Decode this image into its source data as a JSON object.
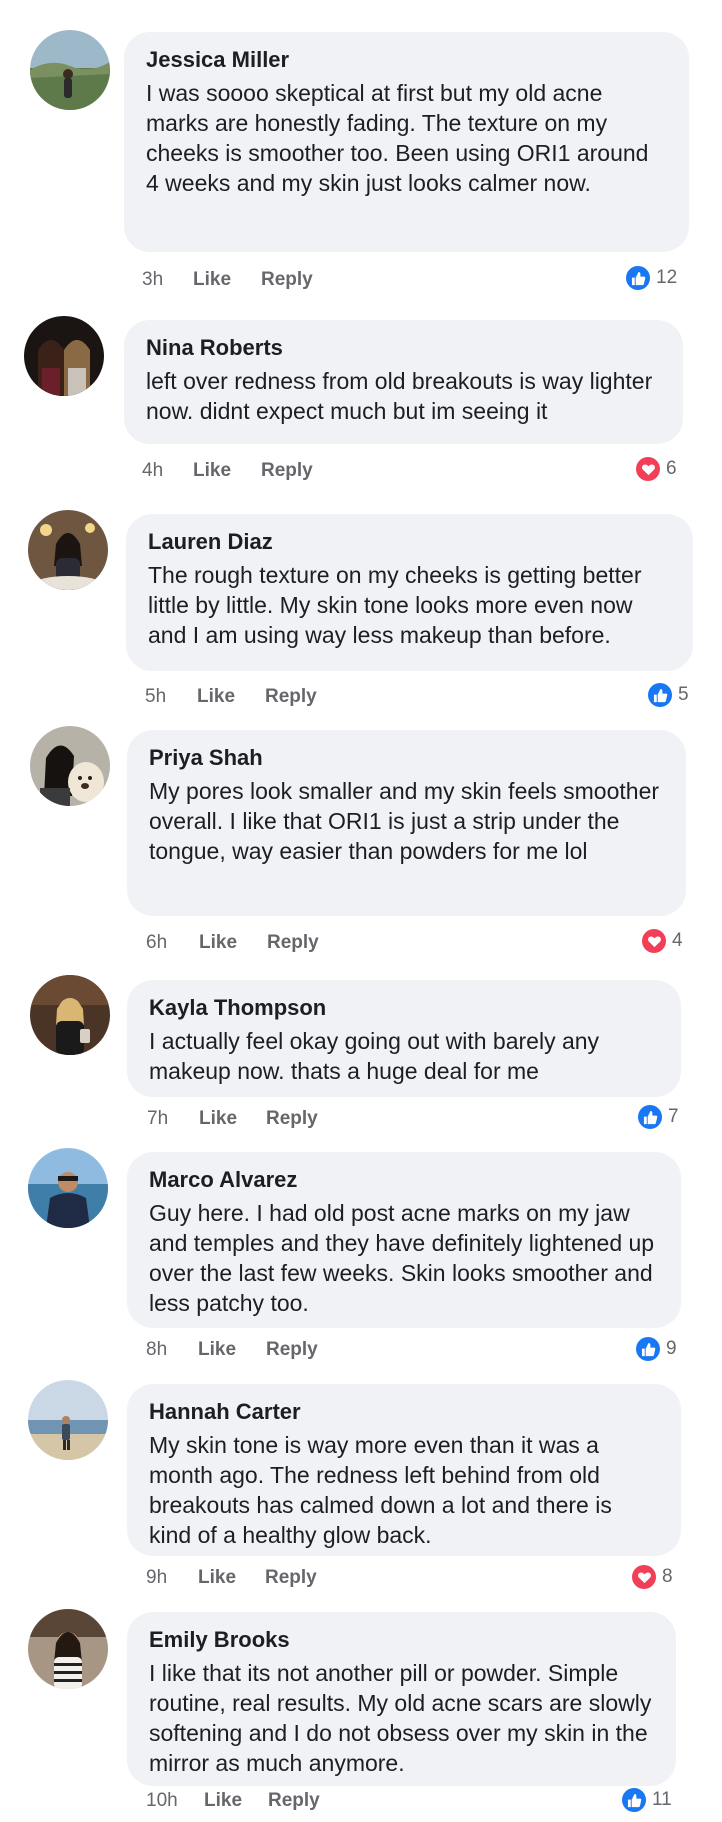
{
  "action_labels": {
    "like": "Like",
    "reply": "Reply"
  },
  "colors": {
    "bubble": "#f0f2f5",
    "like_blue": "#1877f2",
    "love_red": "#f33e58",
    "meta_gray": "#65676b"
  },
  "comments": [
    {
      "name": "Jessica Miller",
      "text": "I was soooo skeptical at first but my old acne marks are honestly fading. The texture on my cheeks is smoother too. Been using ORI1 around 4 weeks and my skin just looks calmer now.",
      "time": "3h",
      "reaction": "like",
      "reaction_icon": "thumbs-up-icon",
      "count": "12"
    },
    {
      "name": "Nina Roberts",
      "text": "left over redness from old breakouts is way lighter now. didnt expect much but im seeing it",
      "time": "4h",
      "reaction": "love",
      "reaction_icon": "heart-icon",
      "count": "6"
    },
    {
      "name": "Lauren Diaz",
      "text": "The rough texture on my cheeks is getting better little by little. My skin tone looks more even now and I am using way less makeup than before.",
      "time": "5h",
      "reaction": "like",
      "reaction_icon": "thumbs-up-icon",
      "count": "5"
    },
    {
      "name": "Priya Shah",
      "text": "My pores look smaller and my skin feels smoother overall. I like that ORI1 is just a strip under the tongue, way easier than powders for me lol",
      "time": "6h",
      "reaction": "love",
      "reaction_icon": "heart-icon",
      "count": "4"
    },
    {
      "name": "Kayla Thompson",
      "text": "I actually feel okay going out with barely any makeup now. thats a huge deal for me",
      "time": "7h",
      "reaction": "like",
      "reaction_icon": "thumbs-up-icon",
      "count": "7"
    },
    {
      "name": "Marco Alvarez",
      "text": "Guy here. I had old post acne marks on my jaw and temples and they have definitely lightened up over the last few weeks. Skin looks smoother and less patchy too.",
      "time": "8h",
      "reaction": "like",
      "reaction_icon": "thumbs-up-icon",
      "count": "9"
    },
    {
      "name": "Hannah Carter",
      "text": "My skin tone is way more even than it was a month ago. The redness left behind from old breakouts has calmed down a lot and there is kind of a healthy glow back.",
      "time": "9h",
      "reaction": "love",
      "reaction_icon": "heart-icon",
      "count": "8"
    },
    {
      "name": "Emily Brooks",
      "text": "I like that its not another pill or powder. Simple routine, real results. My old acne scars are slowly softening and I do not obsess over my skin in the mirror as much anymore.",
      "time": "10h",
      "reaction": "like",
      "reaction_icon": "thumbs-up-icon",
      "count": "11"
    }
  ]
}
